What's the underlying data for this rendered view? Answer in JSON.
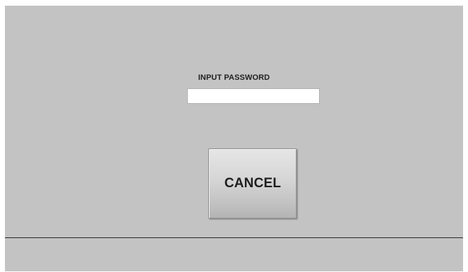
{
  "password_dialog": {
    "label": "INPUT PASSWORD",
    "input_value": "",
    "input_placeholder": "",
    "cancel_label": "CANCEL"
  },
  "colors": {
    "background": "#c3c3c3",
    "input_background": "#ffffff",
    "divider": "#2a2a2a"
  }
}
